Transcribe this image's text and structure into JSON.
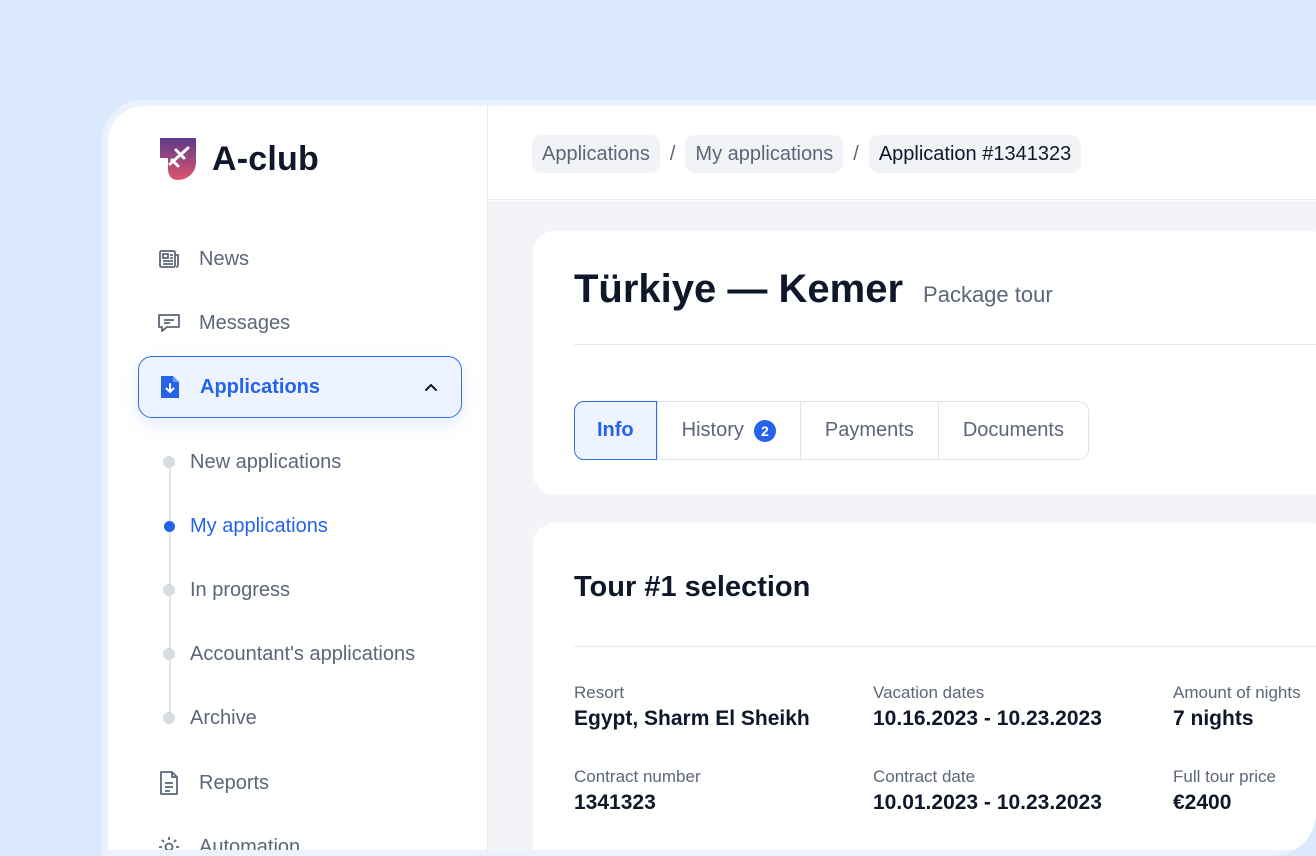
{
  "app": {
    "name": "A-club"
  },
  "sidebar": {
    "items": [
      {
        "label": "News",
        "icon": "newspaper-icon"
      },
      {
        "label": "Messages",
        "icon": "chat-icon"
      },
      {
        "label": "Applications",
        "icon": "document-download-icon",
        "active": true
      },
      {
        "label": "Reports",
        "icon": "document-icon"
      },
      {
        "label": "Automation",
        "icon": "gear-icon"
      }
    ],
    "sub_items": [
      {
        "label": "New applications"
      },
      {
        "label": "My applications",
        "active": true
      },
      {
        "label": "In progress"
      },
      {
        "label": "Accountant's applications"
      },
      {
        "label": "Archive"
      }
    ]
  },
  "breadcrumb": [
    "Applications",
    "My applications",
    "Application #1341323"
  ],
  "header": {
    "title": "Türkiye — Kemer",
    "subtitle": "Package tour"
  },
  "tabs": [
    {
      "label": "Info",
      "active": true
    },
    {
      "label": "History",
      "badge": "2"
    },
    {
      "label": "Payments"
    },
    {
      "label": "Documents"
    }
  ],
  "tour": {
    "title": "Tour #1 selection",
    "fields": [
      {
        "label": "Resort",
        "value": "Egypt, Sharm El Sheikh"
      },
      {
        "label": "Vacation dates",
        "value": "10.16.2023 - 10.23.2023"
      },
      {
        "label": "Amount of nights",
        "value": "7 nights"
      },
      {
        "label": "Contract number",
        "value": "1341323"
      },
      {
        "label": "Contract date",
        "value": "10.01.2023 - 10.23.2023"
      },
      {
        "label": "Full tour price",
        "value": "€2400"
      }
    ]
  },
  "colors": {
    "accent": "#2563eb",
    "background": "#dbe9fd",
    "logo_top": "#5b3a8c",
    "logo_bottom": "#e0556b"
  }
}
